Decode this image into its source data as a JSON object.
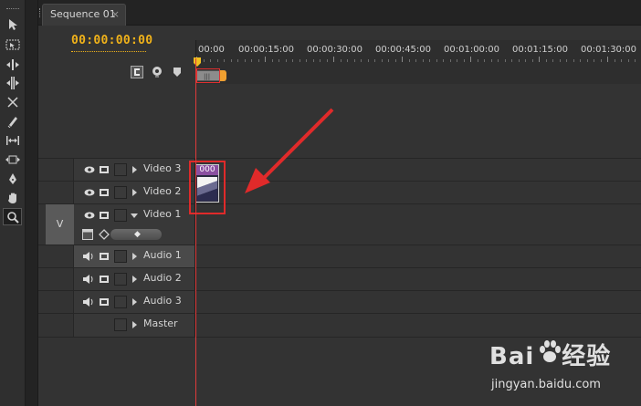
{
  "tab": {
    "title": "Sequence 01",
    "close": "×"
  },
  "timeline": {
    "timecode": "00:00:00:00",
    "ruler_labels": [
      "00:00",
      "00:00:15:00",
      "00:00:30:00",
      "00:00:45:00",
      "00:01:00:00",
      "00:01:15:00",
      "00:01:30:00"
    ]
  },
  "tracks": {
    "video": [
      {
        "name": "Video 3"
      },
      {
        "name": "Video 2"
      },
      {
        "name": "Video 1",
        "expanded": true,
        "source_patch": "V"
      }
    ],
    "audio": [
      {
        "name": "Audio 1",
        "selected": true
      },
      {
        "name": "Audio 2"
      },
      {
        "name": "Audio 3"
      }
    ],
    "master": {
      "name": "Master"
    }
  },
  "clip": {
    "label": "000"
  },
  "watermark": {
    "brand": "Bai",
    "brand_suffix": "经验",
    "url": "jingyan.baidu.com"
  },
  "colors": {
    "timecode": "#f0b21a",
    "playhead": "#e03a3a",
    "annotation": "#e02a2a",
    "clip_label": "#8a4fa0"
  },
  "icons": {
    "tools": [
      "selection-tool-icon",
      "track-select-tool-icon",
      "ripple-edit-tool-icon",
      "rolling-edit-tool-icon",
      "rate-stretch-tool-icon",
      "razor-tool-icon",
      "slip-tool-icon",
      "slide-tool-icon",
      "pen-tool-icon",
      "hand-tool-icon",
      "zoom-tool-icon"
    ],
    "header": [
      "snap-icon",
      "set-marker-icon",
      "marker-icon"
    ]
  }
}
